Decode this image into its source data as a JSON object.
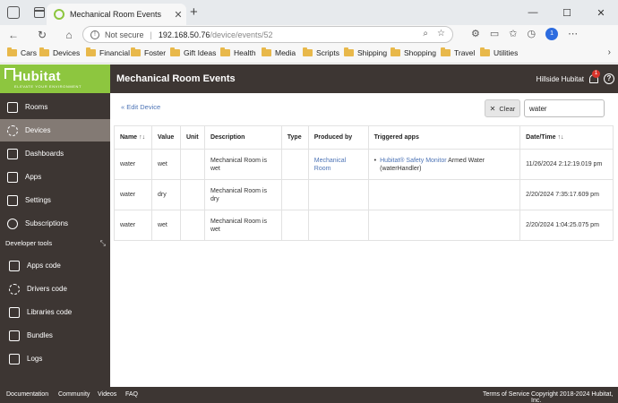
{
  "browser": {
    "tab_title": "Mechanical Room Events",
    "not_secure": "Not secure",
    "url_host": "192.168.50.76",
    "url_path": "/device/events/52",
    "bookmarks": [
      "Cars",
      "Devices",
      "Financial",
      "Foster",
      "Gift Ideas",
      "Health",
      "Media",
      "Scripts",
      "Shipping",
      "Shopping",
      "Travel",
      "Utilities"
    ],
    "notification_count": "1"
  },
  "logo": {
    "name": "Hubitat",
    "tagline": "ELEVATE YOUR ENVIRONMENT"
  },
  "header": {
    "title": "Mechanical Room Events",
    "hub_name": "Hillside Hubitat",
    "notif_count": "1"
  },
  "sidebar": {
    "items": [
      {
        "label": "Rooms",
        "icon": "rooms-icon"
      },
      {
        "label": "Devices",
        "icon": "devices-icon",
        "active": true
      },
      {
        "label": "Dashboards",
        "icon": "dashboards-icon"
      },
      {
        "label": "Apps",
        "icon": "apps-icon"
      },
      {
        "label": "Settings",
        "icon": "settings-icon"
      },
      {
        "label": "Subscriptions",
        "icon": "subscriptions-icon"
      }
    ],
    "section_title": "Developer tools",
    "dev_items": [
      {
        "label": "Apps code",
        "icon": "apps-code-icon"
      },
      {
        "label": "Drivers code",
        "icon": "drivers-code-icon"
      },
      {
        "label": "Libraries code",
        "icon": "libraries-code-icon"
      },
      {
        "label": "Bundles",
        "icon": "bundles-icon"
      },
      {
        "label": "Logs",
        "icon": "logs-icon"
      }
    ]
  },
  "content": {
    "edit_link": "« Edit Device",
    "clear_label": "Clear",
    "filter_value": "water",
    "columns": [
      "Name",
      "Value",
      "Unit",
      "Description",
      "Type",
      "Produced by",
      "Triggered apps",
      "Date/Time"
    ],
    "rows": [
      {
        "name": "water",
        "value": "wet",
        "unit": "",
        "description": "Mechanical Room is wet",
        "type": "",
        "produced_by": "Mechanical Room",
        "app_link": "Hubitat® Safety Monitor",
        "app_text": " Armed Water (waterHandler)",
        "datetime": "11/26/2024 2:12:19.019 pm"
      },
      {
        "name": "water",
        "value": "dry",
        "unit": "",
        "description": "Mechanical Room is dry",
        "type": "",
        "produced_by": "",
        "app_link": "",
        "app_text": "",
        "datetime": "2/20/2024 7:35:17.609 pm"
      },
      {
        "name": "water",
        "value": "wet",
        "unit": "",
        "description": "Mechanical Room is wet",
        "type": "",
        "produced_by": "",
        "app_link": "",
        "app_text": "",
        "datetime": "2/20/2024 1:04:25.075 pm"
      }
    ]
  },
  "footer": {
    "links": [
      "Documentation",
      "Community",
      "Videos",
      "FAQ"
    ],
    "terms": "Terms of Service",
    "copyright": "Copyright 2018-2024 Hubitat, Inc."
  },
  "colors": {
    "brand_green": "#8dc63f",
    "dark_brown": "#3d3633",
    "active_item": "#837a74",
    "link_blue": "#4d74b6"
  }
}
